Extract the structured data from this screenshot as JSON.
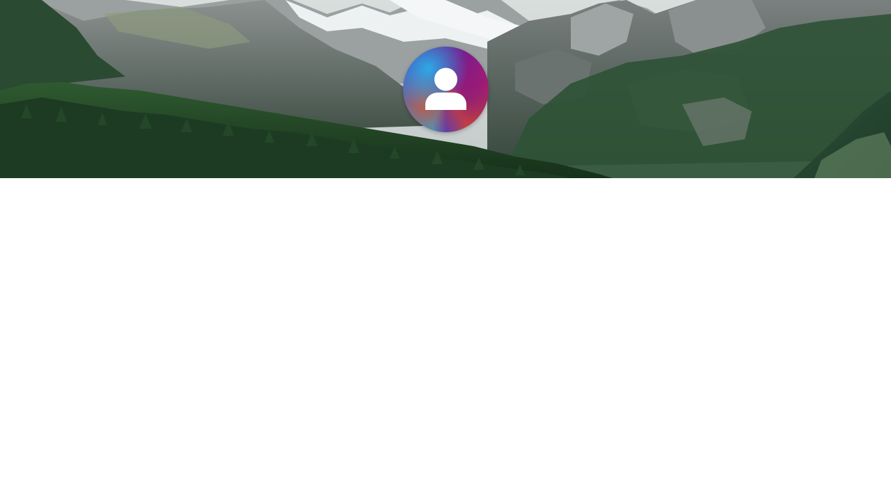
{
  "banner": {
    "image": "mountain-landscape-photo",
    "colors": {
      "sky": "#cfd6d6",
      "snow": "#eef1f2",
      "rock": "#6e7675",
      "forest_dark": "#1c3a22",
      "forest": "#2e5a34",
      "slope": "#3d6b47"
    }
  },
  "profile": {
    "avatar_icon": "user-icon",
    "gradient_colors": [
      "#1fa9e6",
      "#5a2ca0",
      "#b11f6a",
      "#d6482a"
    ]
  }
}
